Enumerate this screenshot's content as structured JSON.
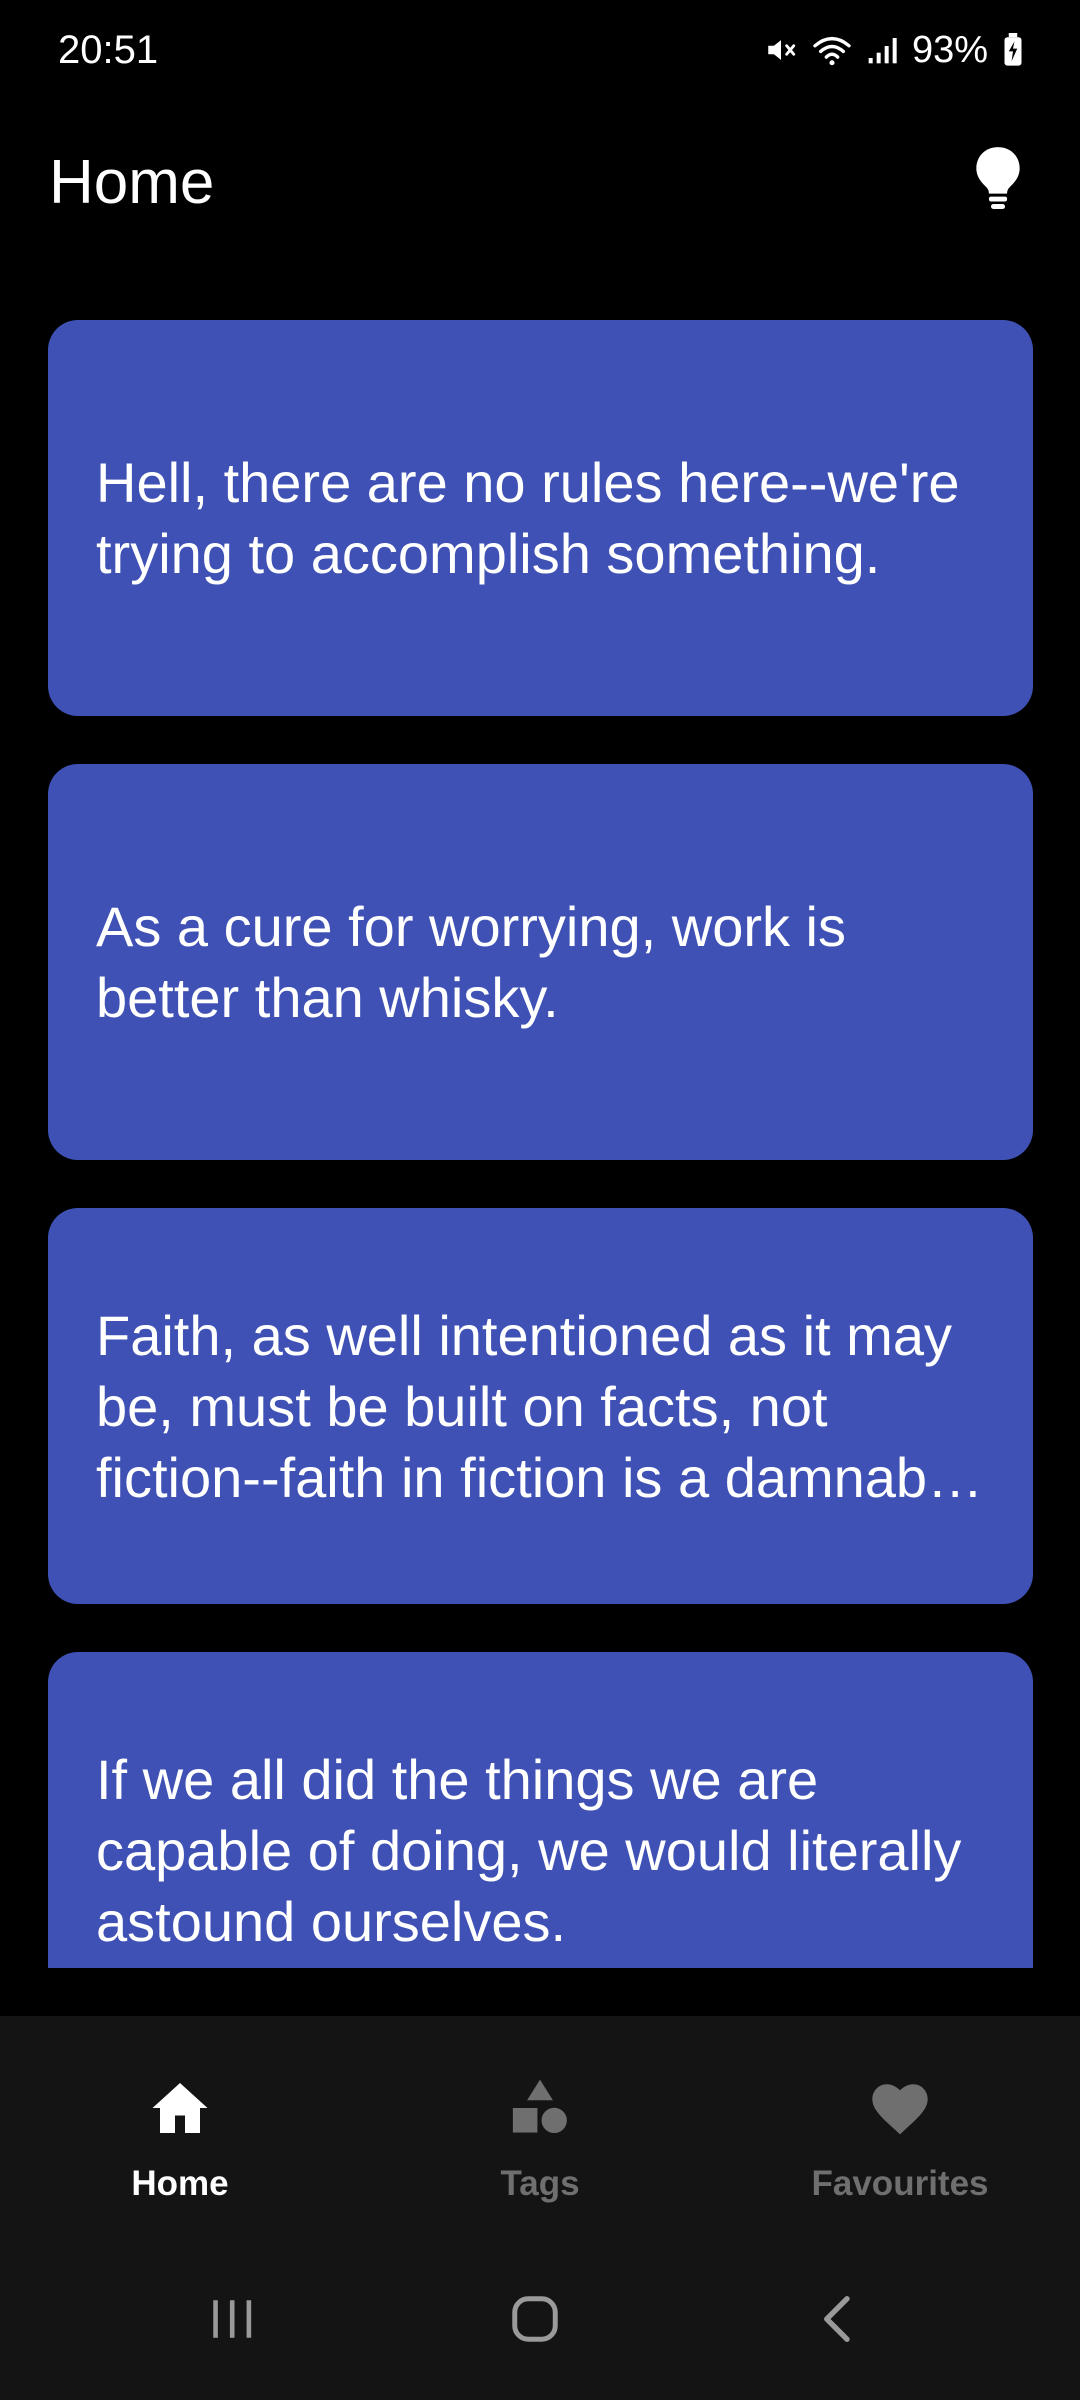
{
  "status_bar": {
    "time": "20:51",
    "battery_percent": "93%",
    "icons": [
      "mute-icon",
      "wifi-icon",
      "signal-icon",
      "battery-charging-icon"
    ]
  },
  "app_bar": {
    "title": "Home",
    "action_icon": "lightbulb-icon"
  },
  "quotes": [
    {
      "text": "Hell, there are no rules here--we're trying to accomplish something."
    },
    {
      "text": "As a cure for worrying, work is better than whisky."
    },
    {
      "text": "Faith, as well intentioned as it may be, must be built on facts, not fiction--faith in fiction is a damnable false hope."
    },
    {
      "text": "If we all did the things we are capable of doing, we would literally astound ourselves."
    }
  ],
  "bottom_nav": {
    "items": [
      {
        "label": "Home",
        "icon": "home-icon",
        "active": true
      },
      {
        "label": "Tags",
        "icon": "shapes-icon",
        "active": false
      },
      {
        "label": "Favourites",
        "icon": "heart-icon",
        "active": false
      }
    ]
  },
  "system_nav": {
    "buttons": [
      "recents-icon",
      "home-circle-icon",
      "back-icon"
    ]
  },
  "colors": {
    "background": "#000000",
    "card": "#3f51b5",
    "nav_background": "#141414",
    "nav_active": "#ffffff",
    "nav_inactive": "#6f6f6f"
  }
}
